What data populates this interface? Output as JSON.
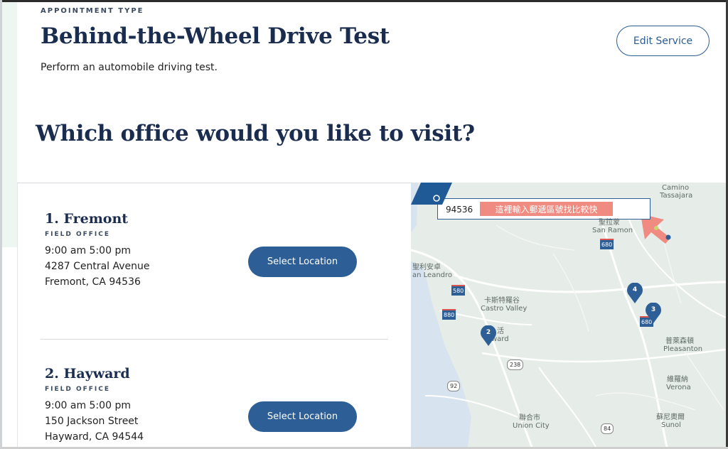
{
  "header": {
    "appointment_label": "APPOINTMENT TYPE",
    "title": "Behind-the-Wheel Drive Test",
    "subtitle": "Perform an automobile driving test.",
    "edit_button": "Edit Service"
  },
  "question": "Which office would you like to visit?",
  "offices": [
    {
      "name": "1. Fremont",
      "type": "FIELD OFFICE",
      "hours": "9:00 am 5:00 pm",
      "address": "4287 Central Avenue",
      "city": "Fremont, CA 94536",
      "button": "Select Location"
    },
    {
      "name": "2. Hayward",
      "type": "FIELD OFFICE",
      "hours": "9:00 am 5:00 pm",
      "address": "150 Jackson Street",
      "city": "Hayward, CA 94544",
      "button": "Select Location"
    }
  ],
  "map": {
    "zip_value": "94536",
    "hint_text": "這裡輸入郵遞區號找比較快",
    "go_icon": "arrow-right-icon",
    "labels": {
      "camino": "Camino",
      "tassajara": "Tassajara",
      "san_ramon_cn": "聖拉蒙",
      "san_ramon": "San Ramon",
      "san_leandro_cn": "聖利安卓",
      "san_leandro": "an Leandro",
      "castro_valley_cn": "卡斯特羅谷",
      "castro_valley": "Castro Valley",
      "hayward_cn": "活",
      "hayward": "ward",
      "pleasanton_cn": "普萊森頓",
      "pleasanton": "Pleasanton",
      "verona_cn": "維羅納",
      "verona": "Verona",
      "union_city_cn": "聯合市",
      "union_city": "Union City",
      "sunol_cn": "蘇尼奧爾",
      "sunol": "Sunol"
    },
    "highway_shields": [
      "680",
      "580",
      "880",
      "680",
      "238",
      "92",
      "84"
    ],
    "pins": [
      "2",
      "3",
      "4"
    ]
  },
  "colors": {
    "navy": "#1b2d4f",
    "button_blue": "#2d5f96",
    "hint_salmon": "#ef8b80",
    "map_bg": "#e6ece8"
  }
}
